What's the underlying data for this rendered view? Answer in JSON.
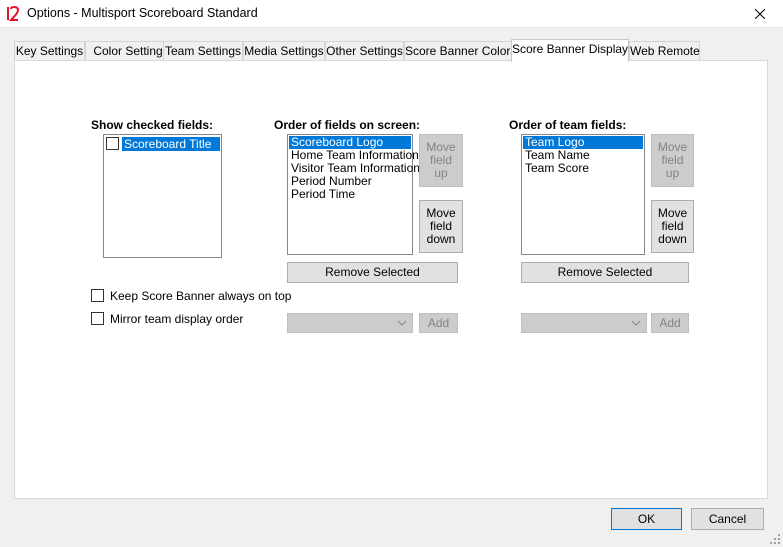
{
  "window": {
    "title": "Options - Multisport Scoreboard Standard"
  },
  "tabs": [
    {
      "label": "Key Settings"
    },
    {
      "label": "Color Settings"
    },
    {
      "label": "Team Settings"
    },
    {
      "label": "Media Settings"
    },
    {
      "label": "Other Settings"
    },
    {
      "label": "Score Banner Colors"
    },
    {
      "label": "Score Banner Display",
      "active": true
    },
    {
      "label": "Web Remote"
    }
  ],
  "show_checked": {
    "label": "Show checked fields:",
    "items": [
      {
        "label": "Scoreboard Title",
        "checked": false,
        "selected": true
      }
    ]
  },
  "order_fields": {
    "label": "Order of fields on screen:",
    "items": [
      {
        "label": "Scoreboard Logo",
        "selected": true
      },
      {
        "label": "Home Team Information"
      },
      {
        "label": "Visitor Team Information"
      },
      {
        "label": "Period Number"
      },
      {
        "label": "Period Time"
      }
    ],
    "move_up_label": "Move\nfield\nup",
    "move_down_label": "Move\nfield\ndown",
    "remove_label": "Remove Selected",
    "combo_value": "",
    "add_label": "Add"
  },
  "order_team": {
    "label": "Order of team fields:",
    "items": [
      {
        "label": "Team Logo",
        "selected": true
      },
      {
        "label": "Team Name"
      },
      {
        "label": "Team Score"
      }
    ],
    "move_up_label": "Move\nfield\nup",
    "move_down_label": "Move\nfield\ndown",
    "remove_label": "Remove Selected",
    "combo_value": "",
    "add_label": "Add"
  },
  "options": {
    "keep_on_top": {
      "label": "Keep Score Banner always on top",
      "checked": false
    },
    "mirror_order": {
      "label": "Mirror team display order",
      "checked": false
    }
  },
  "footer": {
    "ok_label": "OK",
    "cancel_label": "Cancel"
  },
  "colors": {
    "selection": "#0078d7",
    "app_icon": "#e81123"
  }
}
